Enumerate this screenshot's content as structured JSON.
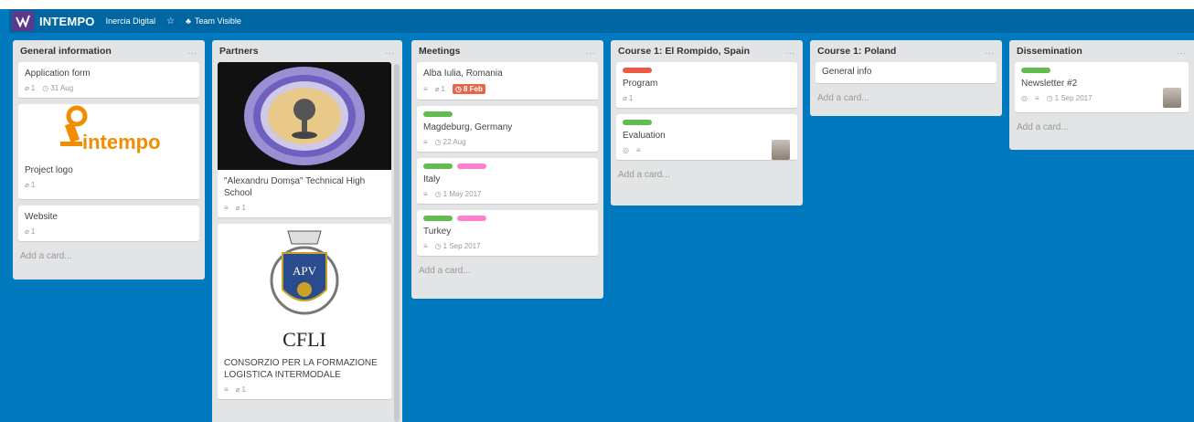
{
  "header": {
    "brand": "INTEMPO",
    "organization": "Inercia Digital",
    "visibility": "Team Visible"
  },
  "lists": [
    {
      "title": "General information",
      "menu": "...",
      "cards": [
        {
          "title": "Application form",
          "attachments": "1",
          "due": "31 Aug"
        },
        {
          "title": "Project logo",
          "attachments": "1",
          "cover_text": "intempo"
        },
        {
          "title": "Website",
          "attachments": "1"
        }
      ],
      "add_card": "Add a card..."
    },
    {
      "title": "Partners",
      "menu": "...",
      "cards": [
        {
          "title": "\"Alexandru Domșa\" Technical High School",
          "attachments": "1"
        },
        {
          "title": "CONSORZIO PER LA FORMAZIONE LOGISTICA INTERMODALE",
          "attachments": "1",
          "cover_text": "APV",
          "cover_caption": "CFLI"
        }
      ]
    },
    {
      "title": "Meetings",
      "menu": "...",
      "cards": [
        {
          "title": "Alba Iulia, Romania",
          "attachments": "1",
          "due": "8 Feb"
        },
        {
          "title": "Magdeburg, Germany",
          "due": "22 Aug"
        },
        {
          "title": "Italy",
          "due": "1 May 2017"
        },
        {
          "title": "Turkey",
          "due": "1 Sep 2017"
        }
      ],
      "add_card": "Add a card..."
    },
    {
      "title": "Course 1: El Rompido, Spain",
      "menu": "...",
      "cards": [
        {
          "title": "Program",
          "attachments": "1"
        },
        {
          "title": "Evaluation"
        }
      ],
      "add_card": "Add a card..."
    },
    {
      "title": "Course 1: Poland",
      "menu": "...",
      "cards": [
        {
          "title": "General info"
        }
      ],
      "add_card": "Add a card..."
    },
    {
      "title": "Dissemination",
      "menu": "...",
      "cards": [
        {
          "title": "Newsletter #2",
          "due": "1 Sep 2017"
        }
      ],
      "add_card": "Add a card..."
    }
  ],
  "colors": {
    "board_bg": "#0179bf",
    "header_bg": "#0067a3",
    "list_bg": "#e2e4e6",
    "label_green": "#61bd4f",
    "label_pink": "#ff80ce",
    "label_red": "#eb5a46",
    "due_overdue": "#e4674a"
  }
}
